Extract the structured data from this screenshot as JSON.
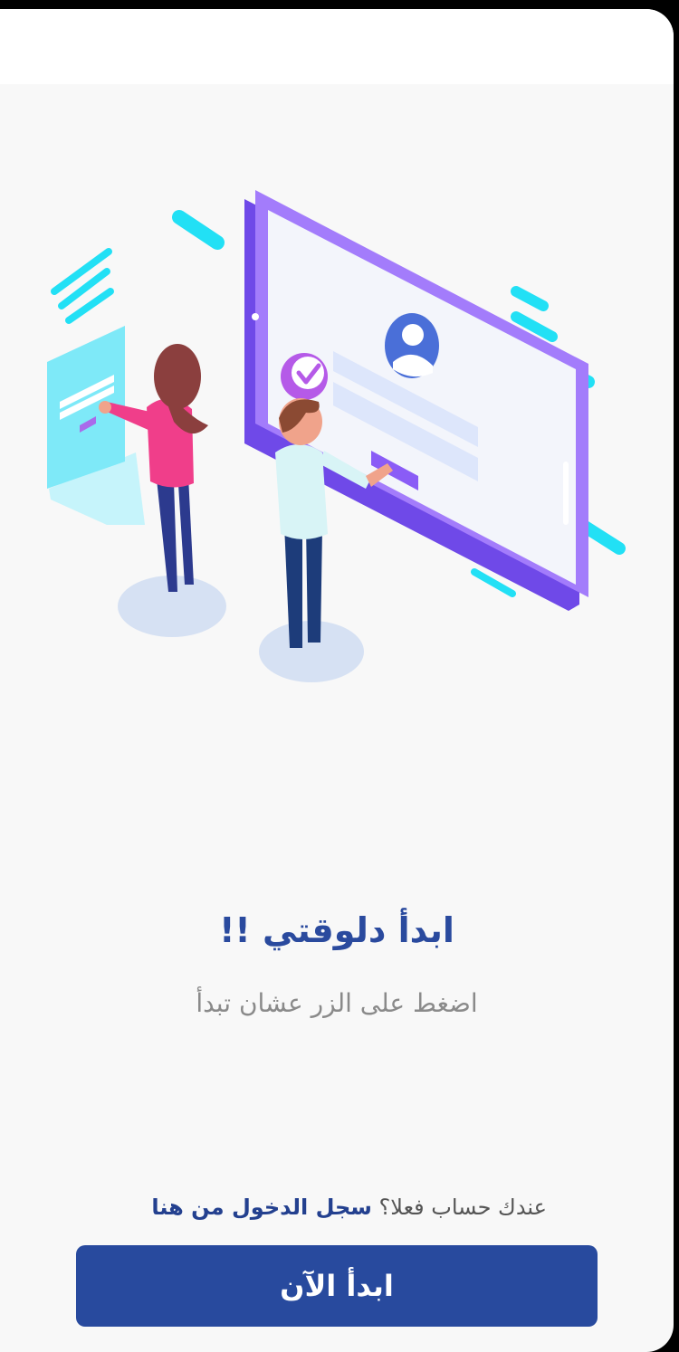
{
  "onboarding": {
    "title": "ابدأ دلوقتي !!",
    "subtitle": "اضغط على الزر عشان تبدأ",
    "login_prompt": "عندك حساب فعلا؟",
    "login_link": "سجل الدخول من هنا",
    "cta_label": "ابدأ الآن"
  },
  "colors": {
    "accent": "#284a9e",
    "title": "#2a4a9e",
    "purple": "#8a5cf6",
    "cyan": "#22e0f5"
  }
}
